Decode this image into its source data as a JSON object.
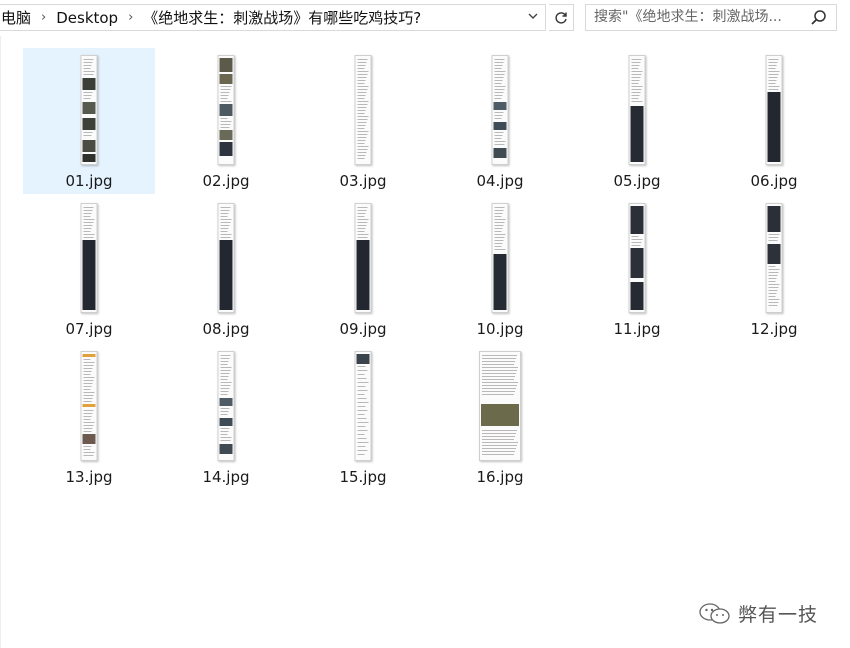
{
  "breadcrumb": {
    "items": [
      "电脑",
      "Desktop",
      "《绝地求生：刺激战场》有哪些吃鸡技巧?"
    ],
    "separator": "›"
  },
  "search": {
    "placeholder": "搜索\"《绝地求生：刺激战场..."
  },
  "files": [
    {
      "name": "01.jpg",
      "style": "dark-photos",
      "selected": true
    },
    {
      "name": "02.jpg",
      "style": "photos-heavy",
      "selected": false
    },
    {
      "name": "03.jpg",
      "style": "text",
      "selected": false
    },
    {
      "name": "04.jpg",
      "style": "text-photos",
      "selected": false
    },
    {
      "name": "05.jpg",
      "style": "text-dark-bottom",
      "selected": false
    },
    {
      "name": "06.jpg",
      "style": "dark-table",
      "selected": false
    },
    {
      "name": "07.jpg",
      "style": "dark-table",
      "selected": false
    },
    {
      "name": "08.jpg",
      "style": "dark-table",
      "selected": false
    },
    {
      "name": "09.jpg",
      "style": "dark-table",
      "selected": false
    },
    {
      "name": "10.jpg",
      "style": "text-dark-bottom",
      "selected": false
    },
    {
      "name": "11.jpg",
      "style": "dark-mixed",
      "selected": false
    },
    {
      "name": "12.jpg",
      "style": "dark-top-text",
      "selected": false
    },
    {
      "name": "13.jpg",
      "style": "orange-list",
      "selected": false
    },
    {
      "name": "14.jpg",
      "style": "text-photos",
      "selected": false
    },
    {
      "name": "15.jpg",
      "style": "text-light",
      "selected": false
    },
    {
      "name": "16.jpg",
      "style": "wide-article",
      "selected": false
    }
  ],
  "watermark": {
    "text": "弊有一技",
    "icon": "wechat-icon"
  }
}
